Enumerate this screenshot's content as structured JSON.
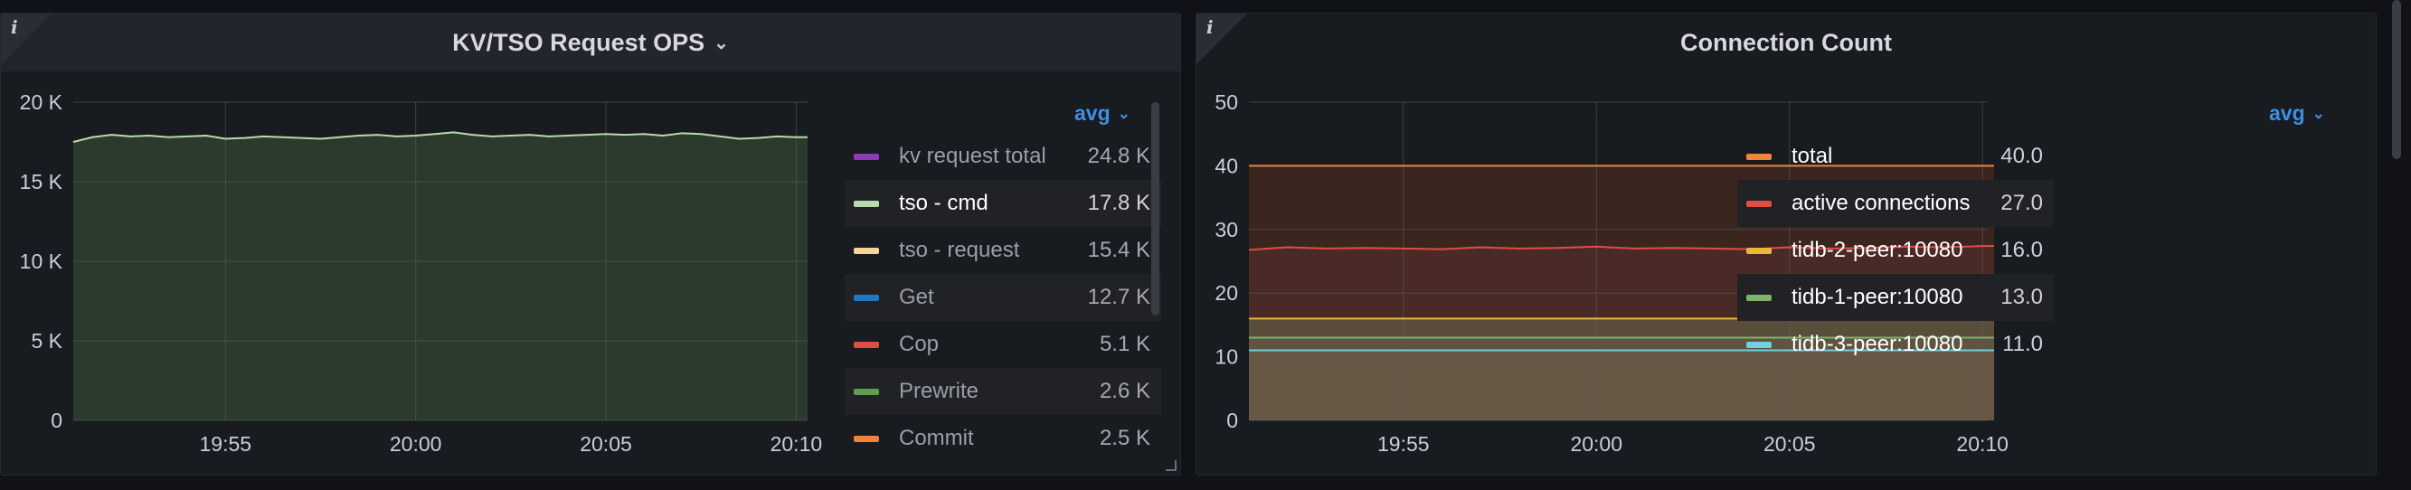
{
  "panels": [
    {
      "title": "KV/TSO Request OPS",
      "title_chevron_icon": "chevron-down-icon",
      "info_icon": "info-icon",
      "legend_header": "avg",
      "legend": [
        {
          "name": "kv request total",
          "value": "24.8 K",
          "color": "#8f3bb8"
        },
        {
          "name": "tso - cmd",
          "value": "17.8 K",
          "color": "#b7dbab"
        },
        {
          "name": "tso - request",
          "value": "15.4 K",
          "color": "#f4d598"
        },
        {
          "name": "Get",
          "value": "12.7 K",
          "color": "#1f78c1"
        },
        {
          "name": "Cop",
          "value": "5.1 K",
          "color": "#e24d42"
        },
        {
          "name": "Prewrite",
          "value": "2.6 K",
          "color": "#629e51"
        },
        {
          "name": "Commit",
          "value": "2.5 K",
          "color": "#ef843c"
        }
      ]
    },
    {
      "title": "Connection Count",
      "info_icon": "info-icon",
      "legend_header": "avg",
      "legend": [
        {
          "name": "total",
          "value": "40.0",
          "color": "#ef843c"
        },
        {
          "name": "active connections",
          "value": "27.0",
          "color": "#e24d42"
        },
        {
          "name": "tidb-2-peer:10080",
          "value": "16.0",
          "color": "#eab839"
        },
        {
          "name": "tidb-1-peer:10080",
          "value": "13.0",
          "color": "#7eb26d"
        },
        {
          "name": "tidb-3-peer:10080",
          "value": "11.0",
          "color": "#6ed0e0"
        }
      ]
    }
  ],
  "chart_data": [
    {
      "type": "area",
      "title": "KV/TSO Request OPS",
      "x_ticks": [
        "19:55",
        "20:00",
        "20:05",
        "20:10"
      ],
      "x_tick_minutes": [
        55,
        60,
        65,
        70
      ],
      "x_range_minutes": [
        51.0,
        70.3
      ],
      "y_ticks": [
        "0",
        "5 K",
        "10 K",
        "15 K",
        "20 K"
      ],
      "y_tick_values": [
        0,
        5000,
        10000,
        15000,
        20000
      ],
      "ylim": [
        0,
        20000
      ],
      "grid": true,
      "legend_placement": "right",
      "series": [
        {
          "name": "tso - cmd",
          "color": "#b7dbab",
          "fill": "#2c3a2d",
          "x_minutes": [
            51.0,
            51.5,
            52.0,
            52.5,
            53.0,
            53.5,
            54.0,
            54.5,
            55.0,
            55.5,
            56.0,
            56.5,
            57.0,
            57.5,
            58.0,
            58.5,
            59.0,
            59.5,
            60.0,
            60.5,
            61.0,
            61.5,
            62.0,
            62.5,
            63.0,
            63.5,
            64.0,
            64.5,
            65.0,
            65.5,
            66.0,
            66.5,
            67.0,
            67.5,
            68.0,
            68.5,
            69.0,
            69.5,
            70.0,
            70.3
          ],
          "values": [
            17500,
            17800,
            17950,
            17850,
            17900,
            17800,
            17850,
            17900,
            17700,
            17750,
            17850,
            17800,
            17750,
            17700,
            17800,
            17900,
            17950,
            17850,
            17900,
            18000,
            18100,
            17950,
            17850,
            17900,
            17950,
            17850,
            17900,
            17950,
            18000,
            17950,
            18000,
            17900,
            18050,
            18000,
            17850,
            17700,
            17750,
            17850,
            17800,
            17800
          ]
        }
      ]
    },
    {
      "type": "area",
      "title": "Connection Count",
      "x_ticks": [
        "19:55",
        "20:00",
        "20:05",
        "20:10"
      ],
      "x_tick_minutes": [
        55,
        60,
        65,
        70
      ],
      "x_range_minutes": [
        51.0,
        70.3
      ],
      "y_ticks": [
        "0",
        "10",
        "20",
        "30",
        "40",
        "50"
      ],
      "y_tick_values": [
        0,
        10,
        20,
        30,
        40,
        50
      ],
      "ylim": [
        0,
        50
      ],
      "grid": true,
      "legend_placement": "right",
      "series": [
        {
          "name": "total",
          "color": "#ef843c",
          "fill": "#3a251f",
          "x_minutes": [
            51.0,
            70.3
          ],
          "values": [
            40.0,
            40.0
          ]
        },
        {
          "name": "active connections",
          "color": "#e24d42",
          "fill": "#4a2a26",
          "x_minutes": [
            51.0,
            52.0,
            53.0,
            54.0,
            55.0,
            56.0,
            57.0,
            58.0,
            59.0,
            60.0,
            61.0,
            62.0,
            63.0,
            64.0,
            65.0,
            66.0,
            67.0,
            68.0,
            69.0,
            70.0,
            70.3
          ],
          "values": [
            26.8,
            27.2,
            27.0,
            27.1,
            27.0,
            26.9,
            27.2,
            27.0,
            27.1,
            27.3,
            27.0,
            27.1,
            27.0,
            26.9,
            27.2,
            27.0,
            27.1,
            27.3,
            27.2,
            27.4,
            27.4
          ]
        },
        {
          "name": "tidb-2-peer:10080",
          "color": "#eab839",
          "fill": "#5a4d3c",
          "x_minutes": [
            51.0,
            70.3
          ],
          "values": [
            16.0,
            16.0
          ]
        },
        {
          "name": "tidb-1-peer:10080",
          "color": "#7eb26d",
          "fill": "#5f5440",
          "x_minutes": [
            51.0,
            70.3
          ],
          "values": [
            13.0,
            13.0
          ]
        },
        {
          "name": "tidb-3-peer:10080",
          "color": "#6ed0e0",
          "fill": "#675846",
          "x_minutes": [
            51.0,
            70.3
          ],
          "values": [
            11.0,
            11.0
          ]
        }
      ]
    }
  ]
}
